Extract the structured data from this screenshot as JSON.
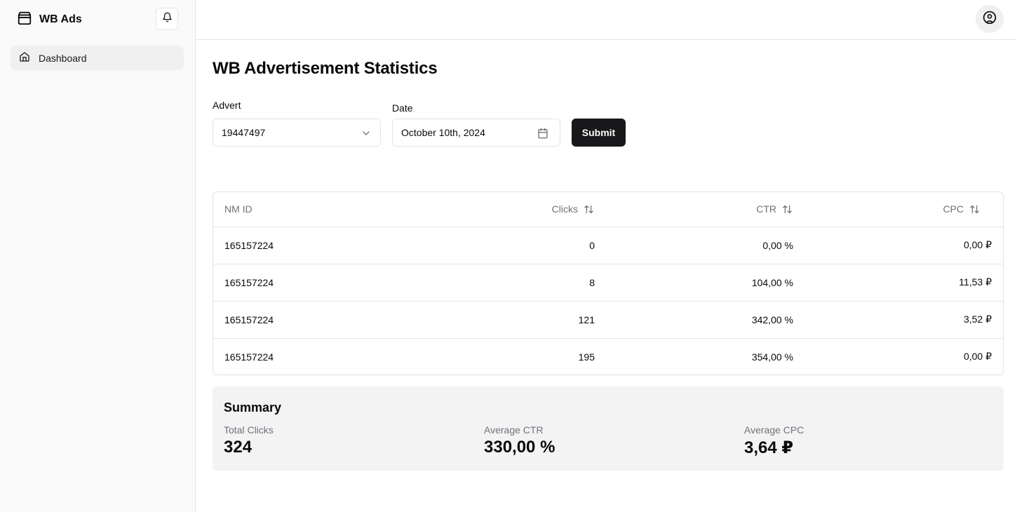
{
  "app": {
    "name": "WB Ads"
  },
  "sidebar": {
    "items": [
      {
        "label": "Dashboard",
        "icon": "home-icon",
        "active": true
      }
    ]
  },
  "page": {
    "title": "WB Advertisement Statistics"
  },
  "form": {
    "advert_label": "Advert",
    "advert_value": "19447497",
    "date_label": "Date",
    "date_value": "October 10th, 2024",
    "submit_label": "Submit"
  },
  "table": {
    "headers": {
      "nm_id": "NM ID",
      "clicks": "Clicks",
      "ctr": "CTR",
      "cpc": "CPC"
    },
    "rows": [
      {
        "nm_id": "165157224",
        "clicks": "0",
        "ctr": "0,00 %",
        "cpc": "0,00 ₽"
      },
      {
        "nm_id": "165157224",
        "clicks": "8",
        "ctr": "104,00 %",
        "cpc": "11,53 ₽"
      },
      {
        "nm_id": "165157224",
        "clicks": "121",
        "ctr": "342,00 %",
        "cpc": "3,52 ₽"
      },
      {
        "nm_id": "165157224",
        "clicks": "195",
        "ctr": "354,00 %",
        "cpc": "0,00 ₽"
      }
    ]
  },
  "summary": {
    "title": "Summary",
    "total_clicks_label": "Total Clicks",
    "total_clicks_value": "324",
    "avg_ctr_label": "Average CTR",
    "avg_ctr_value": "330,00 %",
    "avg_cpc_label": "Average CPC",
    "avg_cpc_value": "3,64 ₽"
  },
  "colors": {
    "primary": "#18181b",
    "border": "#e4e4e7",
    "muted": "#71717a",
    "sidebar_bg": "#fafafa",
    "summary_bg": "#f3f3f4"
  }
}
